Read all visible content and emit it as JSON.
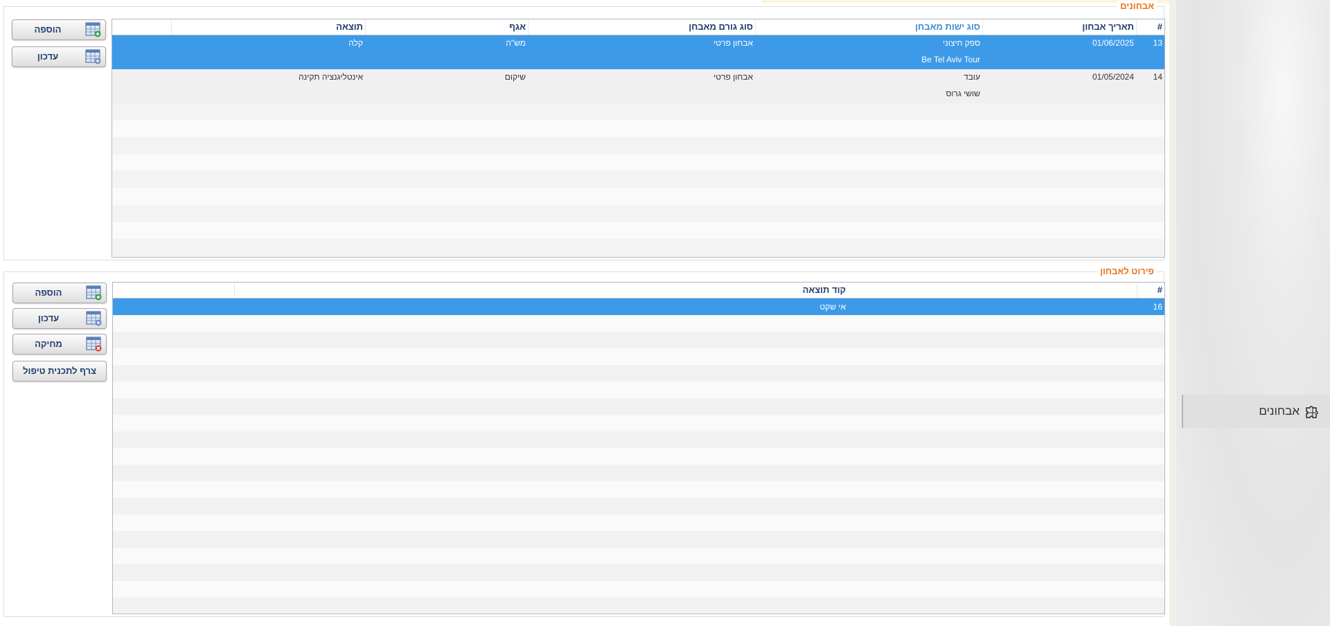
{
  "section_diagnoses": {
    "legend": "אבחונים",
    "buttons": {
      "add": "הוספה",
      "update": "עדכון"
    },
    "columns": {
      "num": "#",
      "date": "תאריך אבחון",
      "entity_type": "סוג ישות מאבחן",
      "diagnoser_type": "סוג  גורם מאבחן",
      "department": "אגף",
      "result": "תוצאה"
    },
    "rows": [
      {
        "num": "13",
        "date": "01/06/2025",
        "entity_type": "ספק חיצוני",
        "entity_name": "Be Tel Aviv Tour",
        "diagnoser_type": "אבחון פרטי",
        "department": "מש\"ה",
        "result": "קלה"
      },
      {
        "num": "14",
        "date": "01/05/2024",
        "entity_type": "עובד",
        "entity_name": "שושי גרוס",
        "diagnoser_type": "אבחון פרטי",
        "department": "שיקום",
        "result": "אינטליגנציה תקינה"
      }
    ]
  },
  "section_details": {
    "legend": "פירוט לאבחון",
    "buttons": {
      "add": "הוספה",
      "update": "עדכון",
      "delete": "מחיקה",
      "attach": "צרף לתכנית טיפול"
    },
    "columns": {
      "num": "#",
      "result_code": "קוד תוצאה"
    },
    "rows": [
      {
        "num": "16",
        "result_code": "אי שקט"
      }
    ]
  },
  "nav": {
    "diagnoses_label": "אבחונים",
    "icon": "puzzle-icon"
  },
  "colors": {
    "accent": "#e8731c",
    "selected": "#3d9ae8",
    "header_text": "#1f3f6b"
  }
}
